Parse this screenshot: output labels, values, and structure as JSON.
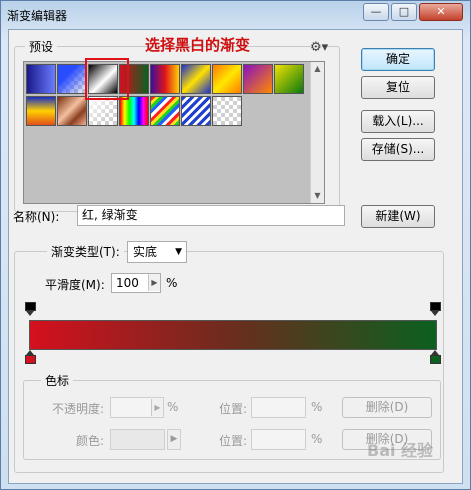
{
  "window": {
    "title": "渐变编辑器"
  },
  "caption_buttons": {
    "minimize": "—",
    "maximize": "□",
    "close": "✕"
  },
  "presets": {
    "label": "预设",
    "annotation": "选择黑白的渐变",
    "swatch_names": [
      "蓝色渐变",
      "蓝到透明",
      "黑白",
      "红到绿",
      "紫红橙",
      "蓝黄蓝",
      "橙黄橙",
      "紫到橙",
      "黄到绿",
      "蓝黄橙",
      "铜色",
      "白到透明",
      "色谱",
      "透明彩虹",
      "透明条纹",
      "透明"
    ]
  },
  "buttons": {
    "ok": "确定",
    "reset": "复位",
    "load": "载入(L)...",
    "save": "存储(S)...",
    "new": "新建(W)"
  },
  "name": {
    "label": "名称(N):",
    "value": "红, 绿渐变"
  },
  "gradient": {
    "type_label": "渐变类型(T):",
    "type_value": "实底",
    "smoothness_label": "平滑度(M):",
    "smoothness_value": "100",
    "smoothness_unit": "%",
    "start_color": "#d50f1e",
    "mid_color": "#6a2d1e",
    "end_color": "#0b6020"
  },
  "stops": {
    "label": "色标",
    "opacity_label": "不透明度:",
    "opacity_unit": "%",
    "location_label": "位置:",
    "location_unit": "%",
    "delete": "删除(D)",
    "color_label": "颜色:",
    "location_label_2": "位置:",
    "location_unit_2": "%",
    "delete_2": "删除(D)"
  },
  "watermark": "Bai 经验"
}
